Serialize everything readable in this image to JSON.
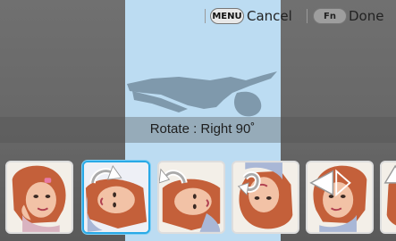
{
  "topbar": {
    "menu_key": "MENU",
    "cancel_label": "Cancel",
    "fn_key": "Fn",
    "done_label": "Done"
  },
  "rotate": {
    "label": "Rotate : Right 90˚"
  },
  "thumbnails": [
    {
      "icon": "none",
      "selected": false
    },
    {
      "icon": "rotate-right-icon",
      "selected": true
    },
    {
      "icon": "rotate-left-icon",
      "selected": false
    },
    {
      "icon": "rotate-180-icon",
      "selected": false
    },
    {
      "icon": "flip-horizontal-icon",
      "selected": false
    },
    {
      "icon": "flip-vertical-icon",
      "selected": false
    }
  ],
  "colors": {
    "highlight": "#bcdcf2",
    "selected_border": "#29a9e6"
  }
}
